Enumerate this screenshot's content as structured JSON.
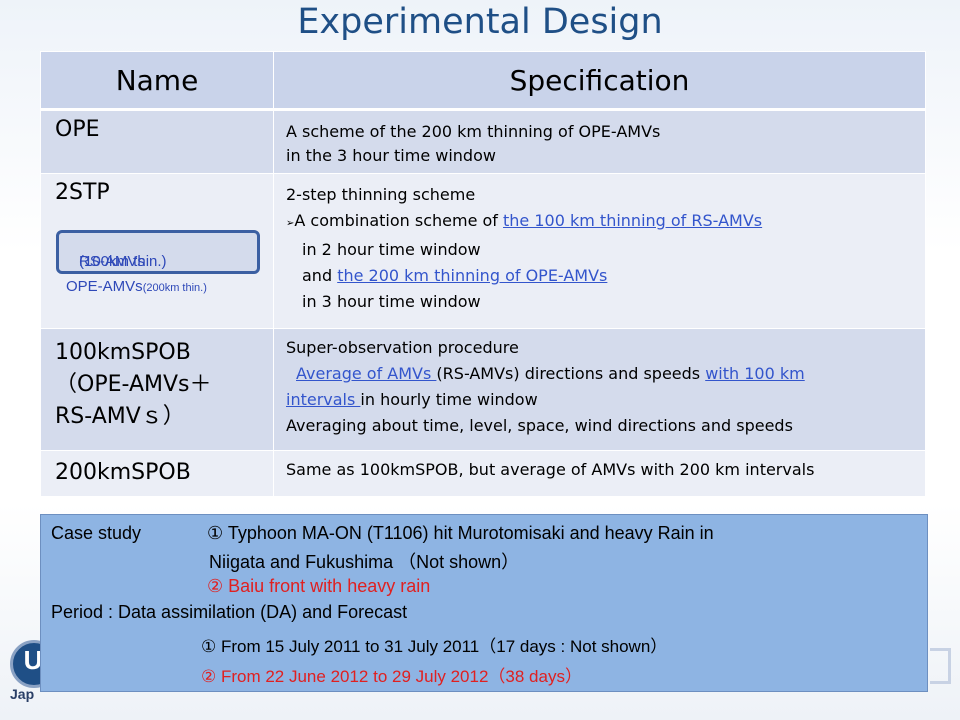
{
  "title": "Experimental Design",
  "table": {
    "headers": [
      "Name",
      "Specification"
    ],
    "rows": [
      {
        "name": "OPE",
        "lines": [
          "A scheme of the 200 km thinning of OPE-AMVs",
          "in the 3 hour time window"
        ]
      },
      {
        "name": "2STP",
        "l1": "2-step thinning scheme",
        "l2_bullet": "➢",
        "l2_a": "A combination scheme of ",
        "l2_link": "the 100 km thinning of  RS-AMVs",
        "l3": "in 2 hour time window",
        "l4_a": "and ",
        "l4_link": "the 200 km thinning of OPE-AMVs",
        "l5": "in 3 hour time window",
        "legend_rs": "RS-AMVs",
        "legend_rs_small": "(100km thin.)",
        "legend_ope": "OPE-AMVs",
        "legend_ope_small": "(200km thin.)"
      },
      {
        "name_l1": "100kmSPOB",
        "name_l2": "（OPE-AMVs＋",
        "name_l3": "RS-AMVｓ）",
        "l1": "Super-observation procedure",
        "l2_link1": "Average of AMVs ",
        "l2_a": "(RS-AMVs) directions and speeds ",
        "l2_link2": "with 100 km",
        "l3_link": "intervals ",
        "l3_a": "in hourly time window",
        "l4": "Averaging about time, level, space, wind directions and speeds"
      },
      {
        "name": "200kmSPOB",
        "line": "Same as 100kmSPOB, but average of AMVs with 200 km intervals"
      }
    ]
  },
  "case_study": {
    "label": "Case study",
    "item1_a": "① Typhoon MA-ON (T1106) hit Murotomisaki and heavy Rain in",
    "item1_b": "Niigata and Fukushima （Not shown）",
    "item2": "② Baiu front with heavy rain",
    "period": "Period : Data assimilation (DA) and Forecast",
    "period1": "① From 15 July 2011 to 31 July 2011（17 days : Not shown）",
    "period2": "② From 22 June 2012 to 29 July 2012（38 days）"
  },
  "logo": {
    "letter": "U",
    "text": "Jap"
  }
}
